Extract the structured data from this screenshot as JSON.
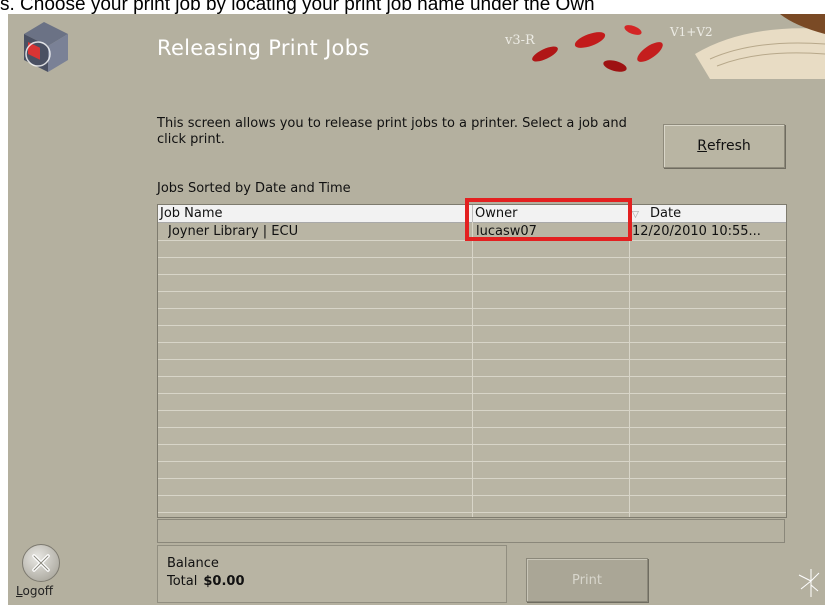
{
  "caption": "s. Choose your print job by locating your print job name under the Own",
  "window": {
    "title": "Releasing Print Jobs",
    "description": "This screen allows you to release print jobs to a printer. Select a job and click print."
  },
  "toolbar": {
    "refresh_label_underlined": "R",
    "refresh_label_rest": "efresh"
  },
  "jobs": {
    "label": "Jobs Sorted by Date and Time",
    "columns": [
      "Job Name",
      "Owner",
      "Date"
    ],
    "rows": [
      {
        "job_name": "Joyner Library | ECU",
        "owner": "lucasw07",
        "date": "12/20/2010 10:55..."
      }
    ]
  },
  "balance": {
    "label": "Balance",
    "total_label": "Total",
    "total_value": "$0.00"
  },
  "print_button": {
    "label": "Print",
    "enabled": false
  },
  "logoff": {
    "label": "Logoff",
    "icon": "x-circle-icon"
  },
  "highlight": {
    "color": "#e32020",
    "target": "Owner"
  },
  "colors": {
    "background": "#b4b09f",
    "title": "#ffffff"
  }
}
